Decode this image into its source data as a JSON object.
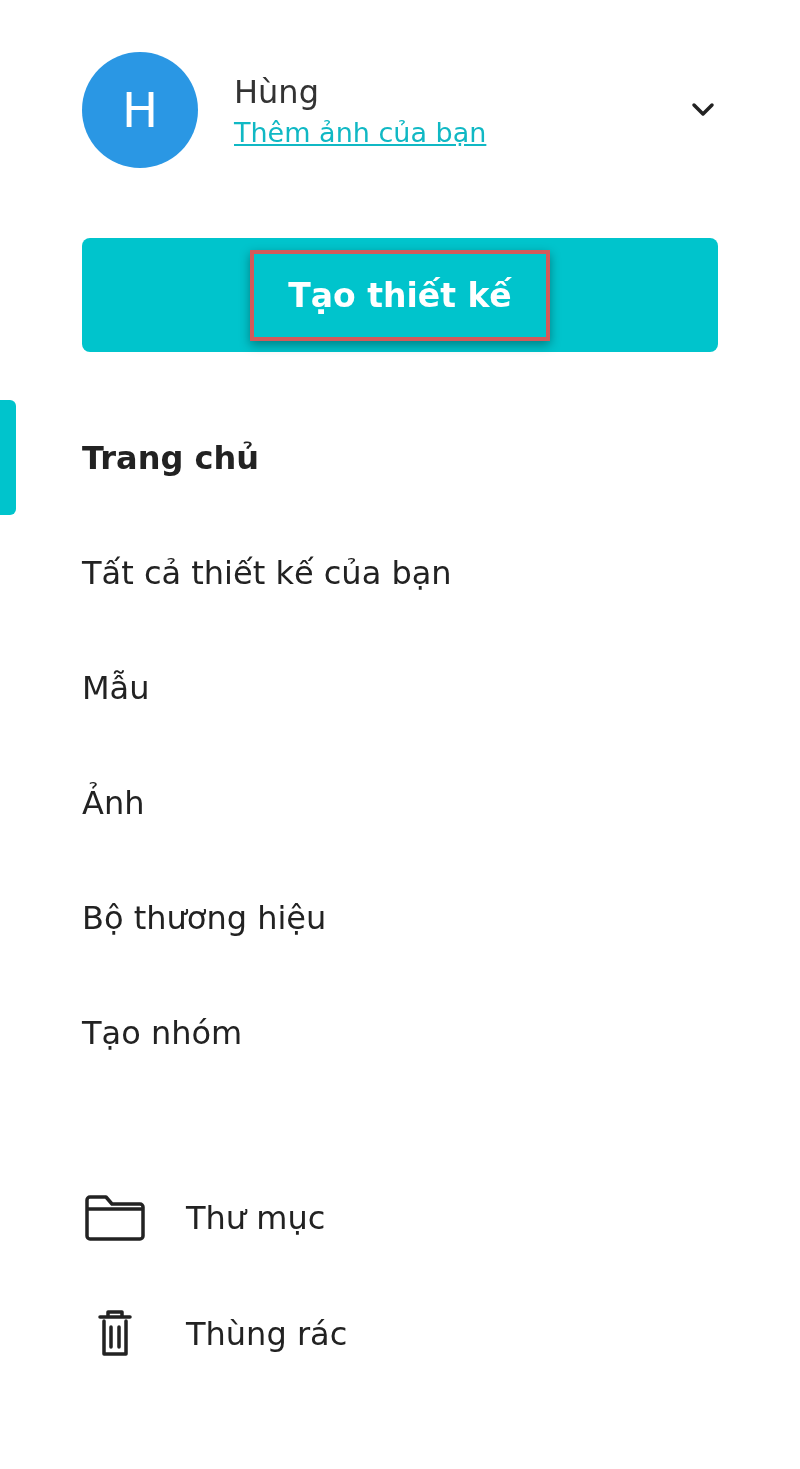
{
  "profile": {
    "initial": "H",
    "name": "Hùng",
    "link": "Thêm ảnh của bạn"
  },
  "create_button": {
    "label": "Tạo thiết kế",
    "highlighted": true
  },
  "nav": [
    {
      "label": "Trang chủ",
      "selected": true
    },
    {
      "label": "Tất cả thiết kế của bạn",
      "selected": false
    },
    {
      "label": "Mẫu",
      "selected": false
    },
    {
      "label": "Ảnh",
      "selected": false
    },
    {
      "label": "Bộ thương hiệu",
      "selected": false
    },
    {
      "label": "Tạo nhóm",
      "selected": false
    }
  ],
  "tools": [
    {
      "kind": "folder",
      "label": "Thư mục"
    },
    {
      "kind": "trash",
      "label": "Thùng rác"
    }
  ]
}
